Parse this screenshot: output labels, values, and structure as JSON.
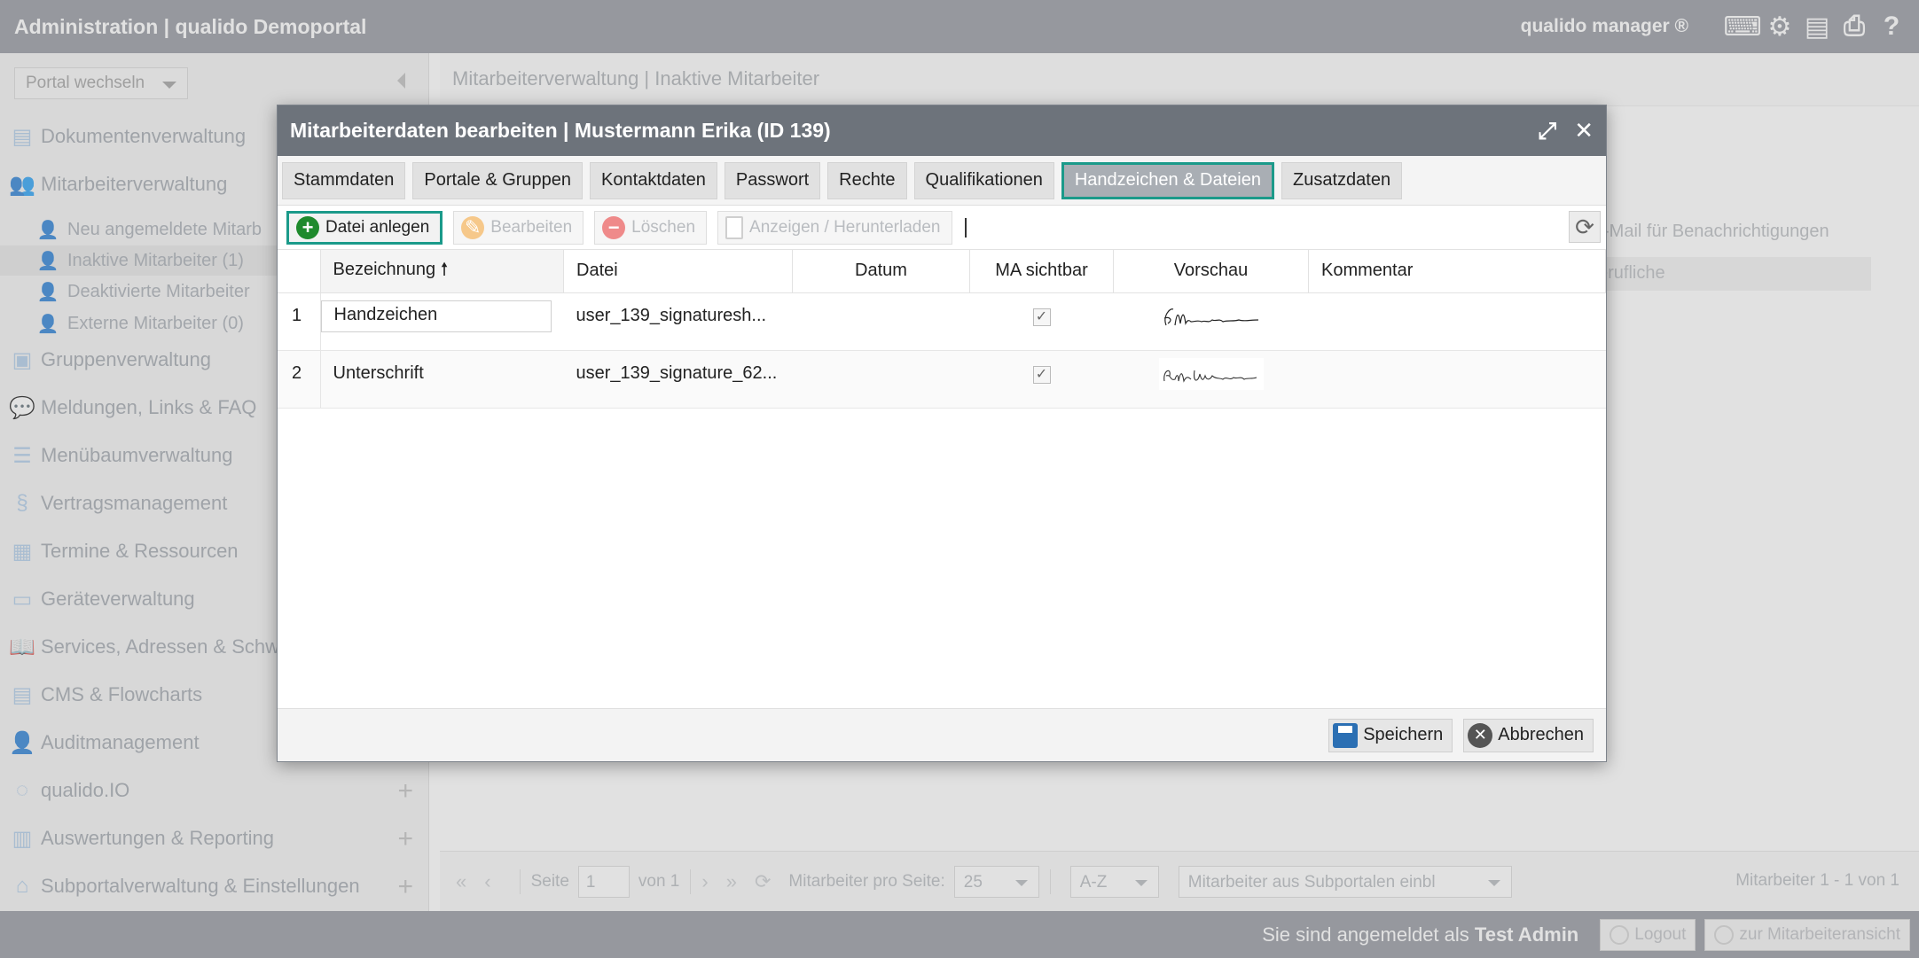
{
  "app": {
    "title": "Administration | qualido Demoportal",
    "brand": "qualido manager ®"
  },
  "sidebar": {
    "portal_select": "Portal wechseln",
    "items": [
      {
        "label": "Dokumentenverwaltung",
        "icon": "documents-icon"
      },
      {
        "label": "Mitarbeiterverwaltung",
        "icon": "users-icon"
      },
      {
        "label": "Gruppenverwaltung",
        "icon": "groups-icon"
      },
      {
        "label": "Meldungen, Links & FAQ",
        "icon": "chat-icon"
      },
      {
        "label": "Menübaumverwaltung",
        "icon": "list-icon"
      },
      {
        "label": "Vertragsmanagement",
        "icon": "paragraph-icon"
      },
      {
        "label": "Termine & Ressourcen",
        "icon": "calendar-icon"
      },
      {
        "label": "Geräteverwaltung",
        "icon": "device-icon"
      },
      {
        "label": "Services, Adressen & Schw",
        "icon": "book-icon"
      },
      {
        "label": "CMS & Flowcharts",
        "icon": "cms-icon"
      },
      {
        "label": "Auditmanagement",
        "icon": "audit-icon"
      },
      {
        "label": "qualido.IO",
        "icon": "io-icon"
      },
      {
        "label": "Auswertungen & Reporting",
        "icon": "chart-icon"
      },
      {
        "label": "Subportalverwaltung & Einstellungen",
        "icon": "home-icon"
      }
    ],
    "sub_items": [
      {
        "label": "Neu angemeldete Mitarb"
      },
      {
        "label": "Inaktive Mitarbeiter (1)"
      },
      {
        "label": "Deaktivierte Mitarbeiter"
      },
      {
        "label": "Externe Mitarbeiter (0)"
      }
    ]
  },
  "main": {
    "header": "Mitarbeiterverwaltung | Inaktive Mitarbeiter",
    "bg_email": "-Mail für Benachrichtigungen",
    "bg_row": "erufliche"
  },
  "pager": {
    "page_label": "Seite",
    "page_value": "1",
    "of_label": "von 1",
    "per_page_label": "Mitarbeiter pro Seite:",
    "per_page_value": "25",
    "sort_value": "A-Z",
    "subportal_select": "Mitarbeiter aus Subportalen einbl",
    "info": "Mitarbeiter 1 - 1 von 1"
  },
  "footer": {
    "login_prefix": "Sie sind angemeldet als",
    "user": "Test Admin",
    "logout": "Logout",
    "employee_view": "zur Mitarbeiteransicht"
  },
  "modal": {
    "title": "Mitarbeiterdaten bearbeiten | Mustermann Erika (ID 139)",
    "tabs": [
      "Stammdaten",
      "Portale & Gruppen",
      "Kontaktdaten",
      "Passwort",
      "Rechte",
      "Qualifikationen",
      "Handzeichen & Dateien",
      "Zusatzdaten"
    ],
    "active_tab": "Handzeichen & Dateien",
    "toolbar": {
      "create": "Datei anlegen",
      "edit": "Bearbeiten",
      "delete": "Löschen",
      "view": "Anzeigen / Herunterladen"
    },
    "columns": {
      "name": "Bezeichnung",
      "file": "Datei",
      "date": "Datum",
      "visible": "MA sichtbar",
      "preview": "Vorschau",
      "comment": "Kommentar"
    },
    "rows": [
      {
        "num": "1",
        "name": "Handzeichen",
        "file": "user_139_signaturesh...",
        "date": "",
        "visible": true,
        "comment": ""
      },
      {
        "num": "2",
        "name": "Unterschrift",
        "file": "user_139_signature_62...",
        "date": "",
        "visible": true,
        "comment": ""
      }
    ],
    "save": "Speichern",
    "cancel": "Abbrechen"
  },
  "colors": {
    "topbar": "#8c9099",
    "modal_header": "#6d737b",
    "accent": "#1b9a8a",
    "create_icon": "#1f8a2d",
    "save_icon": "#2b6fb3"
  }
}
